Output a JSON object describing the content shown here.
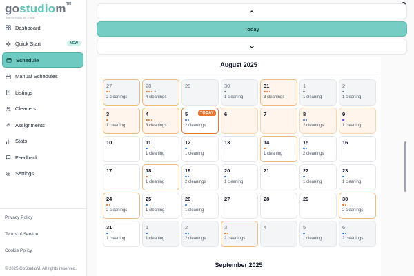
{
  "brand": {
    "part1": "go",
    "part2": "studio",
    "part3": "m",
    "tm": "TM",
    "tagline": "built for hosts, by a host"
  },
  "nav": [
    {
      "label": "Dashboard",
      "icon": "grid-icon"
    },
    {
      "label": "Quick Start",
      "icon": "sparkle-icon",
      "badge": "NEW"
    },
    {
      "label": "Schedule",
      "icon": "calendar-icon",
      "active": true
    },
    {
      "label": "Manual Schedules",
      "icon": "calendar-edit-icon"
    },
    {
      "label": "Listings",
      "icon": "building-icon"
    },
    {
      "label": "Cleaners",
      "icon": "users-icon"
    },
    {
      "label": "Assignments",
      "icon": "link-icon"
    },
    {
      "label": "Stats",
      "icon": "bar-chart-icon"
    },
    {
      "label": "Feedback",
      "icon": "message-icon"
    },
    {
      "label": "Settings",
      "icon": "gear-icon"
    }
  ],
  "footer": {
    "privacy": "Privacy Policy",
    "terms": "Terms of Service",
    "cookie": "Cookie Policy",
    "copyright": "© 2025 GoStudioM. All rights reserved."
  },
  "controls": {
    "today_label": "Today"
  },
  "calendar": {
    "month": "August 2025",
    "next_month": "September 2025",
    "colors": {
      "orange": "#e8772e",
      "blue": "#2f6fd1",
      "gray": "#6b7280",
      "purple": "#7c3aed",
      "today": "#e8772e"
    },
    "today_badge": "TODAY",
    "weeks": [
      [
        {
          "day": "27",
          "out": true,
          "dots": [
            "orange",
            "orange"
          ],
          "label": "2 cleanings",
          "has": true
        },
        {
          "day": "28",
          "out": true,
          "dots": [
            "orange",
            "orange",
            "orange"
          ],
          "extra": "+1",
          "label": "4 cleanings",
          "has": true
        },
        {
          "day": "29",
          "out": true
        },
        {
          "day": "30",
          "out": true,
          "dots": [
            "gray"
          ],
          "label": "1 cleaning"
        },
        {
          "day": "31",
          "out": false,
          "dots": [
            "orange",
            "orange",
            "orange"
          ],
          "label": "3 cleanings",
          "has": true,
          "week": true
        },
        {
          "day": "1",
          "out": true,
          "dots": [
            "gray"
          ],
          "label": "1 cleaning"
        },
        {
          "day": "2",
          "out": true,
          "dots": [
            "gray"
          ],
          "label": "1 cleaning"
        }
      ],
      [
        {
          "day": "3",
          "dots": [
            "orange"
          ],
          "label": "1 cleaning",
          "has": true,
          "week": true
        },
        {
          "day": "4",
          "dots": [
            "orange",
            "orange",
            "orange"
          ],
          "label": "3 cleanings",
          "has": true,
          "week": true
        },
        {
          "day": "5",
          "dots": [
            "blue",
            "blue"
          ],
          "label": "2 cleanings",
          "today": true
        },
        {
          "day": "6",
          "week": true
        },
        {
          "day": "7",
          "week": true
        },
        {
          "day": "8",
          "dots": [
            "blue",
            "blue"
          ],
          "label": "2 cleanings",
          "week": true
        },
        {
          "day": "9",
          "dots": [
            "purple"
          ],
          "label": "1 cleaning",
          "week": true
        }
      ],
      [
        {
          "day": "10"
        },
        {
          "day": "11",
          "dots": [
            "blue"
          ],
          "label": "1 cleaning"
        },
        {
          "day": "12",
          "dots": [
            "blue"
          ],
          "label": "1 cleaning"
        },
        {
          "day": "13"
        },
        {
          "day": "14",
          "dots": [
            "orange"
          ],
          "label": "1 cleaning",
          "has": true
        },
        {
          "day": "15",
          "dots": [
            "blue",
            "blue"
          ],
          "label": "2 cleanings"
        },
        {
          "day": "16"
        }
      ],
      [
        {
          "day": "17"
        },
        {
          "day": "18",
          "dots": [
            "orange"
          ],
          "label": "1 cleaning",
          "has": true
        },
        {
          "day": "19",
          "dots": [
            "blue",
            "blue"
          ],
          "label": "2 cleanings"
        },
        {
          "day": "20",
          "dots": [
            "blue"
          ],
          "label": "1 cleaning"
        },
        {
          "day": "21"
        },
        {
          "day": "22",
          "dots": [
            "blue"
          ],
          "label": "1 cleaning"
        },
        {
          "day": "23",
          "dots": [
            "blue"
          ],
          "label": "1 cleaning"
        }
      ],
      [
        {
          "day": "24",
          "dots": [
            "orange",
            "orange"
          ],
          "label": "2 cleanings",
          "has": true
        },
        {
          "day": "25",
          "dots": [
            "blue"
          ],
          "label": "1 cleaning"
        },
        {
          "day": "26",
          "dots": [
            "blue"
          ],
          "label": "1 cleaning"
        },
        {
          "day": "27"
        },
        {
          "day": "28"
        },
        {
          "day": "29"
        },
        {
          "day": "30",
          "dots": [
            "orange",
            "orange"
          ],
          "label": "2 cleanings",
          "has": true
        }
      ],
      [
        {
          "day": "31",
          "dots": [
            "blue"
          ],
          "label": "1 cleaning"
        },
        {
          "day": "1",
          "out": true,
          "dots": [
            "blue"
          ],
          "label": "1 cleaning"
        },
        {
          "day": "2",
          "out": true,
          "dots": [
            "blue",
            "blue"
          ],
          "label": "2 cleanings"
        },
        {
          "day": "3",
          "out": true,
          "dots": [
            "orange",
            "orange"
          ],
          "label": "2 cleanings",
          "has": true
        },
        {
          "day": "4",
          "out": true
        },
        {
          "day": "5",
          "out": true,
          "dots": [
            "blue"
          ],
          "label": "1 cleaning"
        },
        {
          "day": "6",
          "out": true,
          "dots": [
            "blue",
            "blue"
          ],
          "label": "2 cleanings"
        }
      ]
    ]
  }
}
